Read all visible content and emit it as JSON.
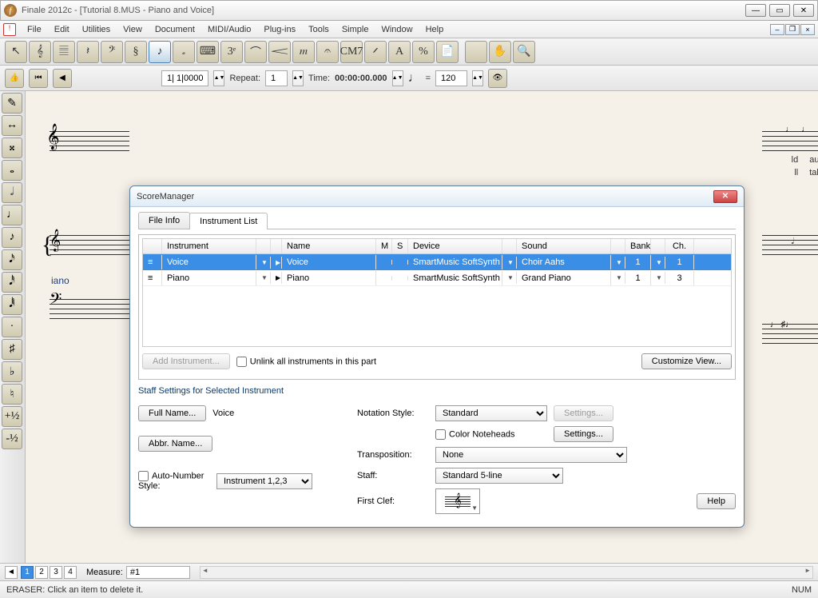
{
  "window": {
    "title": "Finale 2012c - [Tutorial 8.MUS - Piano and Voice]"
  },
  "menu": [
    "File",
    "Edit",
    "Utilities",
    "View",
    "Document",
    "MIDI/Audio",
    "Plug-ins",
    "Tools",
    "Simple",
    "Window",
    "Help"
  ],
  "toolbar_icons": [
    "↖",
    "𝄞",
    "𝄚",
    "𝄽",
    "𝄢",
    "§",
    "♪",
    "𝅗",
    "⌨",
    "3ᵉ",
    "⌒",
    "𝆒",
    "𝆐",
    "𝄐",
    "CM7",
    "𝄍",
    "A",
    "%",
    "📄",
    "",
    "✋",
    "🔍"
  ],
  "transport": {
    "position": "1| 1|0000",
    "repeat_label": "Repeat:",
    "repeat_value": "1",
    "time_label": "Time:",
    "time_value": "00:00:00.000",
    "tempo_note": "♩",
    "equals": "=",
    "tempo_value": "120"
  },
  "side_icons": [
    "✎",
    "↔",
    "𝄪",
    "𝅝",
    "𝅗𝅥",
    "♩",
    "♪",
    "𝅘𝅥𝅯",
    "𝅘𝅥𝅰",
    "𝅘𝅥𝅱",
    "·",
    "♯",
    "♭",
    "♮",
    "+½",
    "-½"
  ],
  "canvas": {
    "inst_label": "iano",
    "lyrics1": "ld",
    "lyrics2": "ll",
    "lyrics3": "auld",
    "lyrics4": "take",
    "fig": "3"
  },
  "modal": {
    "title": "ScoreManager",
    "tabs": {
      "file_info": "File Info",
      "instrument_list": "Instrument List"
    },
    "headers": {
      "instrument": "Instrument",
      "name": "Name",
      "m": "M",
      "s": "S",
      "device": "Device",
      "sound": "Sound",
      "bank": "Bank",
      "ch": "Ch."
    },
    "rows": [
      {
        "instrument": "Voice",
        "name": "Voice",
        "device": "SmartMusic SoftSynth",
        "sound": "Choir Aahs",
        "bank": "1",
        "ch": "1",
        "selected": true
      },
      {
        "instrument": "Piano",
        "name": "Piano",
        "device": "SmartMusic SoftSynth",
        "sound": "Grand Piano",
        "bank": "1",
        "ch": "3",
        "selected": false
      }
    ],
    "add_instrument": "Add Instrument...",
    "unlink": "Unlink all instruments in this part",
    "customize": "Customize View...",
    "group_label": "Staff Settings for Selected Instrument",
    "full_name_btn": "Full Name...",
    "full_name_val": "Voice",
    "abbr_name_btn": "Abbr. Name...",
    "auto_number": "Auto-Number Style:",
    "auto_number_val": "Instrument 1,2,3",
    "notation_style_label": "Notation Style:",
    "notation_style_val": "Standard",
    "settings_btn": "Settings...",
    "color_noteheads": "Color Noteheads",
    "transposition_label": "Transposition:",
    "transposition_val": "None",
    "staff_label": "Staff:",
    "staff_val": "Standard 5-line",
    "first_clef_label": "First Clef:",
    "help": "Help"
  },
  "pager": {
    "pages": [
      "1",
      "2",
      "3",
      "4"
    ],
    "measure_label": "Measure:",
    "measure_val": "#1"
  },
  "status": {
    "message": "ERASER: Click an item to delete it.",
    "num": "NUM"
  }
}
